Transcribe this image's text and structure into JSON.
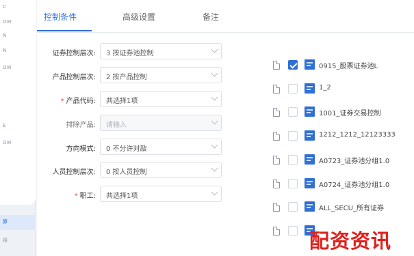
{
  "sidebar": {
    "items": [
      "C",
      "OW",
      "N",
      "N",
      "OW",
      "",
      "",
      "E",
      "",
      "OW",
      "",
      "",
      "",
      ""
    ],
    "bottom_items": [
      "算",
      "报"
    ]
  },
  "tabs": [
    {
      "label": "控制条件",
      "active": true
    },
    {
      "label": "高级设置",
      "active": false
    },
    {
      "label": "备注",
      "active": false
    }
  ],
  "form": {
    "rows": [
      {
        "label": "证券控制层次:",
        "value": "3 按证券池控制",
        "required": false,
        "disabled": false
      },
      {
        "label": "产品控制层次:",
        "value": "2 按产品控制",
        "required": false,
        "disabled": false
      },
      {
        "label": "产品代码:",
        "value": "共选择1项",
        "required": true,
        "disabled": false
      },
      {
        "label": "排除产品:",
        "value": "请输入",
        "required": false,
        "disabled": true
      },
      {
        "label": "方向模式:",
        "value": "0 不分许对敲",
        "required": false,
        "disabled": false
      },
      {
        "label": "人员控制层次:",
        "value": "0 按人员控制",
        "required": false,
        "disabled": false
      },
      {
        "label": "职工:",
        "value": "共选择1项",
        "required": true,
        "disabled": false
      }
    ]
  },
  "list": {
    "items": [
      {
        "label": "0915_股票证券池L",
        "checked": true
      },
      {
        "label": "1_2",
        "checked": false
      },
      {
        "label": "1001_证券交易控制",
        "checked": false
      },
      {
        "label": "1212_1212_12123333",
        "checked": false
      },
      {
        "label": "A0723_证券池分组1.0",
        "checked": false
      },
      {
        "label": "A0724_证券池分组1.0",
        "checked": false
      },
      {
        "label": "ALL_SECU_所有证券",
        "checked": false
      },
      {
        "label": "",
        "checked": false
      }
    ]
  },
  "watermark": "配资资讯",
  "colors": {
    "accent": "#2f6fd6",
    "watermark": "#e0201c"
  }
}
